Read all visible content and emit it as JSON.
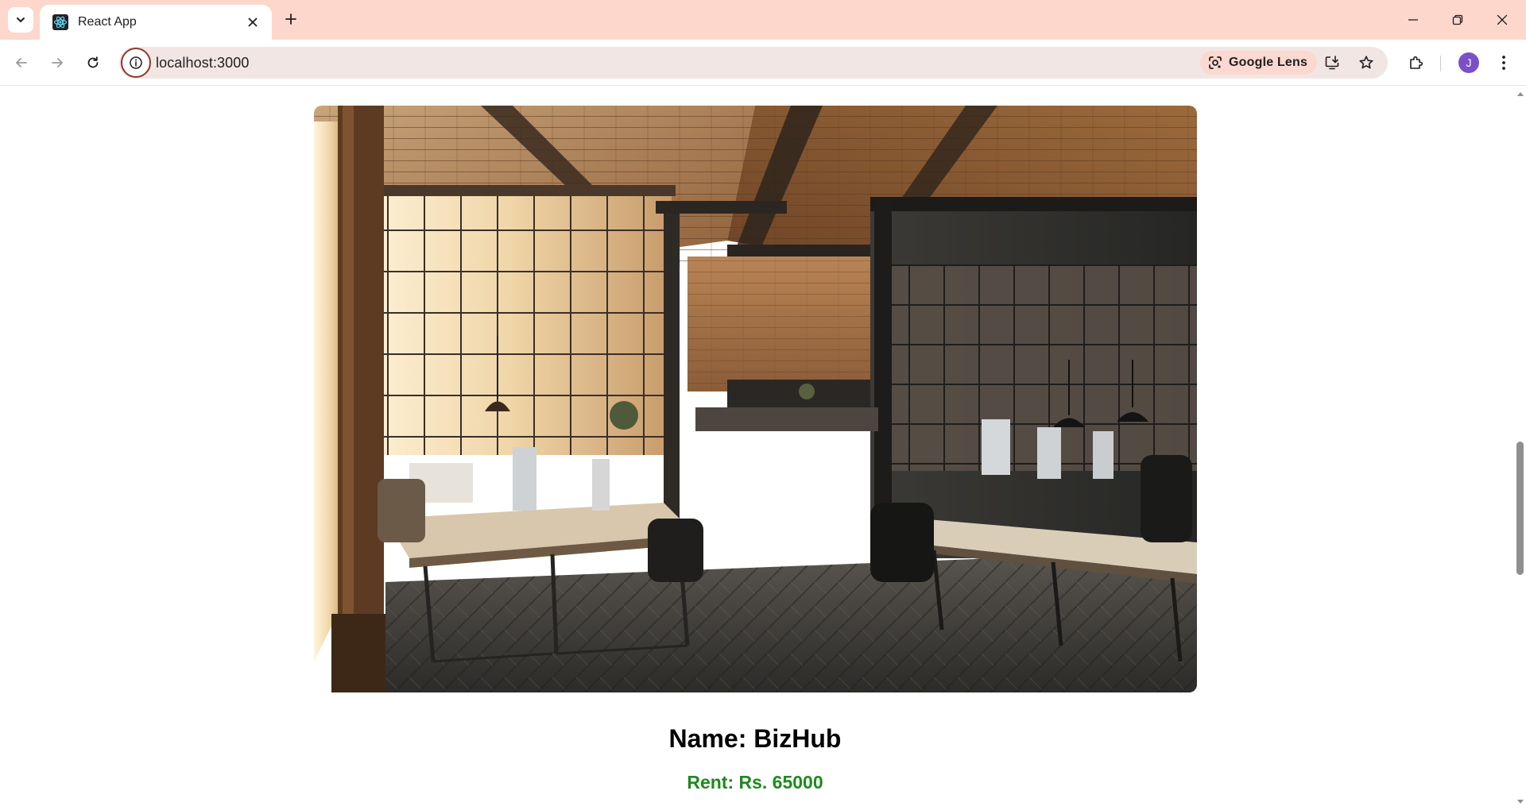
{
  "browser": {
    "tab": {
      "title": "React App"
    },
    "address_bar": {
      "url": "localhost:3000"
    },
    "lens_chip": {
      "label": "Google Lens"
    },
    "profile": {
      "initial": "J",
      "color": "#7b4fc8"
    },
    "icons": {
      "tab_search": "chevron-down-icon",
      "tab_close": "close-icon",
      "new_tab": "plus-icon",
      "back": "arrow-left-icon",
      "forward": "arrow-right-icon",
      "reload": "reload-icon",
      "site_info": "info-icon",
      "install": "install-app-icon",
      "bookmark": "star-icon",
      "extensions": "puzzle-icon",
      "menu": "kebab-menu-icon"
    },
    "colors": {
      "tabstrip": "#fdd7cc",
      "omnibox": "#f2e6e4"
    }
  },
  "listing": {
    "image_alt": "Industrial loft office with brick walls and wooden desks",
    "name": "Name: BizHub",
    "rent": "Rent: Rs. 65000",
    "rent_color": "#1e8a1e"
  }
}
